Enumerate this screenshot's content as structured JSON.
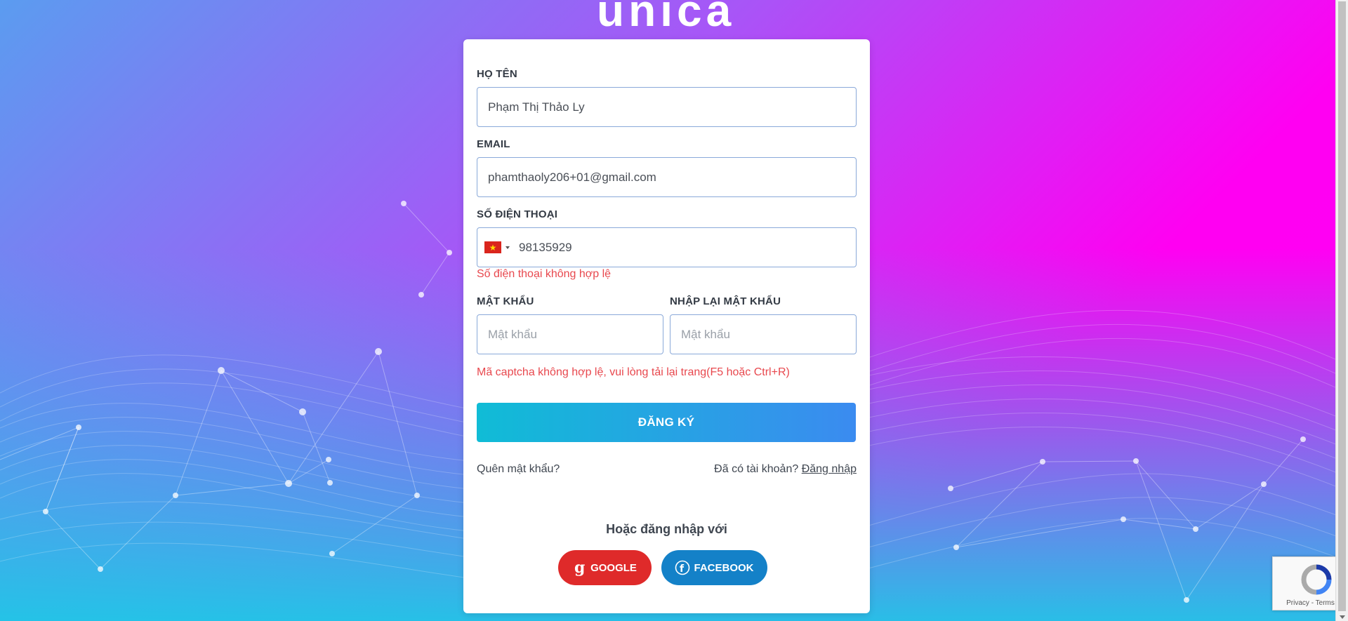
{
  "brand": {
    "logo_text": "unica"
  },
  "form": {
    "name": {
      "label": "HỌ TÊN",
      "value": "Phạm Thị Thảo Ly"
    },
    "email": {
      "label": "EMAIL",
      "value": "phamthaoly206+01@gmail.com"
    },
    "phone": {
      "label": "SỐ ĐIỆN THOẠI",
      "country_flag": "vietnam-flag-icon",
      "value": "98135929",
      "error": "Số điện thoại không hợp lệ"
    },
    "password": {
      "label": "MẬT KHẨU",
      "placeholder": "Mật khẩu"
    },
    "confirm_password": {
      "label": "NHẬP LẠI MẬT KHẨU",
      "placeholder": "Mật khẩu"
    },
    "captcha_error": "Mã captcha không hợp lệ, vui lòng tải lại trang(F5 hoặc Ctrl+R)",
    "submit_label": "ĐĂNG KÝ"
  },
  "links": {
    "forgot_password": "Quên mật khẩu?",
    "have_account": "Đã có tài khoản?",
    "login": "Đăng nhập"
  },
  "social": {
    "heading": "Hoặc đăng nhập với",
    "google_label": "GOOGLE",
    "facebook_label": "FACEBOOK"
  },
  "recaptcha": {
    "terms": "Privacy - Terms"
  },
  "colors": {
    "gradient_start": "#5b9cf0",
    "gradient_mid": "#a855f7",
    "gradient_end": "#ff00f2",
    "submit_start": "#10bcd6",
    "submit_end": "#3b8bf0",
    "error": "#e8484e",
    "google": "#df2a2a",
    "facebook": "#1481c8"
  }
}
